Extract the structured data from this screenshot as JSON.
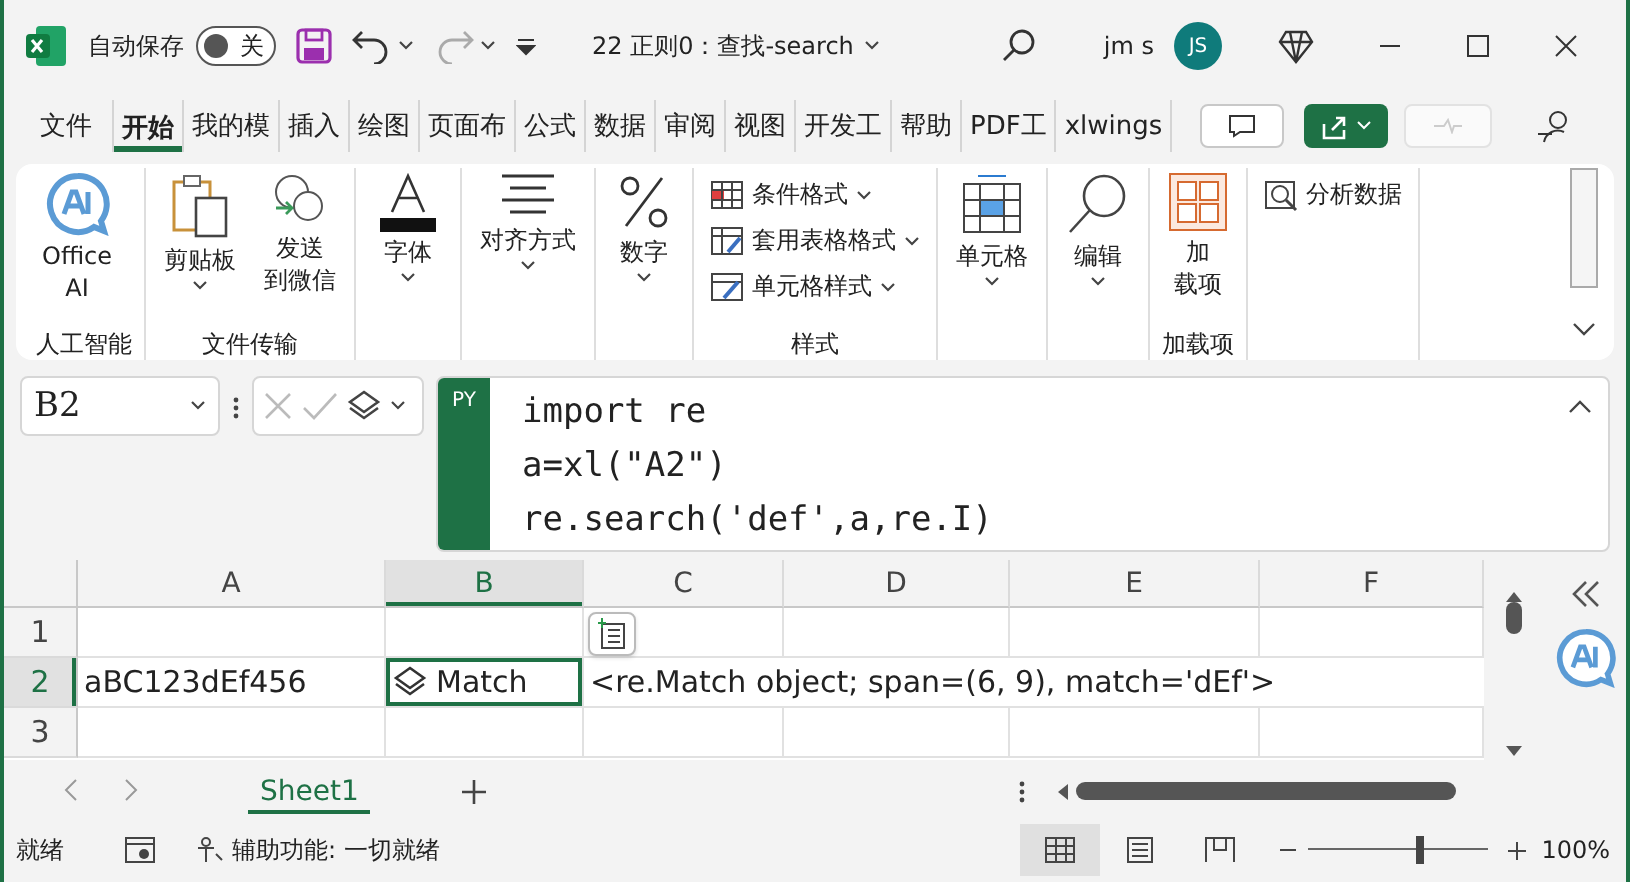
{
  "title_bar": {
    "autosave_label": "自动保存",
    "autosave": {
      "on": false,
      "label": "关"
    },
    "document_title": "22 正则0：查找-search",
    "user_name": "jm s",
    "avatar_initials": "JS"
  },
  "ribbon_tabs": [
    {
      "label": "文件",
      "selected": false
    },
    {
      "label": "开始",
      "selected": true
    },
    {
      "label": "我的模",
      "selected": false
    },
    {
      "label": "插入",
      "selected": false
    },
    {
      "label": "绘图",
      "selected": false
    },
    {
      "label": "页面布",
      "selected": false
    },
    {
      "label": "公式",
      "selected": false
    },
    {
      "label": "数据",
      "selected": false
    },
    {
      "label": "审阅",
      "selected": false
    },
    {
      "label": "视图",
      "selected": false
    },
    {
      "label": "开发工",
      "selected": false
    },
    {
      "label": "帮助",
      "selected": false
    },
    {
      "label": "PDF工",
      "selected": false
    },
    {
      "label": "xlwings",
      "selected": false
    }
  ],
  "ribbon_groups": [
    {
      "label": "人工智能",
      "kind": "large",
      "commands": [
        {
          "lines": [
            "Office",
            "AI"
          ],
          "dropdown": false
        }
      ]
    },
    {
      "label": "文件传输",
      "kind": "large",
      "commands": [
        {
          "lines": [
            "剪贴板"
          ],
          "dropdown": true
        },
        {
          "lines": [
            "发送",
            "到微信"
          ],
          "dropdown": false
        }
      ]
    },
    {
      "kind": "large",
      "commands": [
        {
          "lines": [
            "字体"
          ],
          "dropdown": true
        }
      ]
    },
    {
      "kind": "large",
      "commands": [
        {
          "lines": [
            "对齐方式"
          ],
          "dropdown": true
        }
      ]
    },
    {
      "kind": "large",
      "commands": [
        {
          "lines": [
            "数字"
          ],
          "dropdown": true
        }
      ]
    },
    {
      "label": "样式",
      "kind": "stack",
      "commands": [
        {
          "label": "条件格式",
          "dropdown": true
        },
        {
          "label": "套用表格格式",
          "dropdown": true
        },
        {
          "label": "单元格样式",
          "dropdown": true
        }
      ]
    },
    {
      "kind": "large",
      "commands": [
        {
          "lines": [
            "单元格"
          ],
          "dropdown": true
        }
      ]
    },
    {
      "kind": "large",
      "commands": [
        {
          "lines": [
            "编辑"
          ],
          "dropdown": true
        }
      ]
    },
    {
      "label": "加载项",
      "kind": "large",
      "commands": [
        {
          "lines": [
            "加",
            "载项"
          ],
          "dropdown": false
        }
      ]
    },
    {
      "kind": "stack",
      "commands": [
        {
          "label": "分析数据",
          "dropdown": false
        }
      ]
    }
  ],
  "formula_bar": {
    "name_box": "B2",
    "language_badge": "PY",
    "code_lines": [
      "import re",
      "a=xl(\"A2\")",
      "re.search('def',a,re.I)"
    ]
  },
  "grid": {
    "columns": [
      {
        "label": "A",
        "selected": false
      },
      {
        "label": "B",
        "selected": true
      },
      {
        "label": "C",
        "selected": false
      },
      {
        "label": "D",
        "selected": false
      },
      {
        "label": "E",
        "selected": false
      },
      {
        "label": "F",
        "selected": false
      }
    ],
    "rows": [
      {
        "label": "1",
        "selected": false,
        "cells": []
      },
      {
        "label": "2",
        "selected": true,
        "cells": [
          {
            "text": "aBC123dEf456",
            "selected": false,
            "kind": "text"
          },
          {
            "text": "Match",
            "selected": true,
            "kind": "python-object"
          },
          {
            "text": "<re.Match object; span=(6, 9), match='dEf'>",
            "selected": false,
            "kind": "text"
          }
        ]
      },
      {
        "label": "3",
        "selected": false,
        "cells": []
      }
    ]
  },
  "sheet_tabs": [
    {
      "label": "Sheet1",
      "selected": true
    }
  ],
  "status_bar": {
    "status": "就绪",
    "accessibility": "辅助功能: 一切就绪",
    "views": [
      {
        "selected": true
      },
      {
        "selected": false
      },
      {
        "selected": false
      }
    ],
    "zoom": {
      "level": 0.6,
      "label": "100%"
    }
  }
}
